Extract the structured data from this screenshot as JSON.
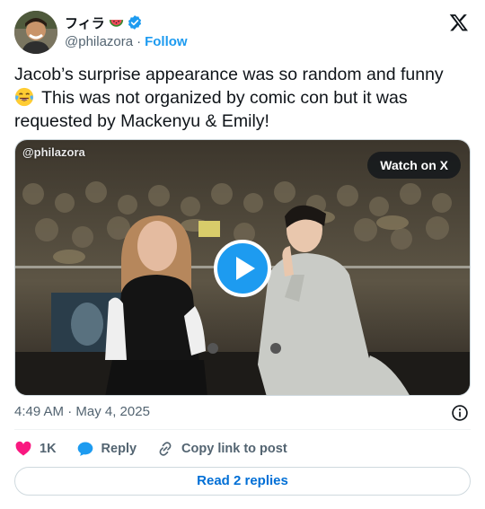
{
  "author": {
    "name": "フィラ",
    "handle": "@philazora",
    "separator": "·",
    "follow_label": "Follow",
    "verified": true
  },
  "tweet": {
    "text_line1": "Jacob’s surprise appearance was so random and funny",
    "text_line2": " This was not organized by comic con but it was requested by Mackenyu & Emily!",
    "emoji": "face-with-tears-of-joy"
  },
  "media": {
    "watermark": "@philazora",
    "watch_label": "Watch on X"
  },
  "meta": {
    "timestamp": "4:49 AM · May 4, 2025"
  },
  "actions": {
    "likes": "1K",
    "reply_label": "Reply",
    "copy_label": "Copy link to post"
  },
  "replies_button": "Read 2 replies",
  "colors": {
    "accent": "#1d9bf0",
    "like": "#f91880",
    "secondary_text": "#536471"
  }
}
